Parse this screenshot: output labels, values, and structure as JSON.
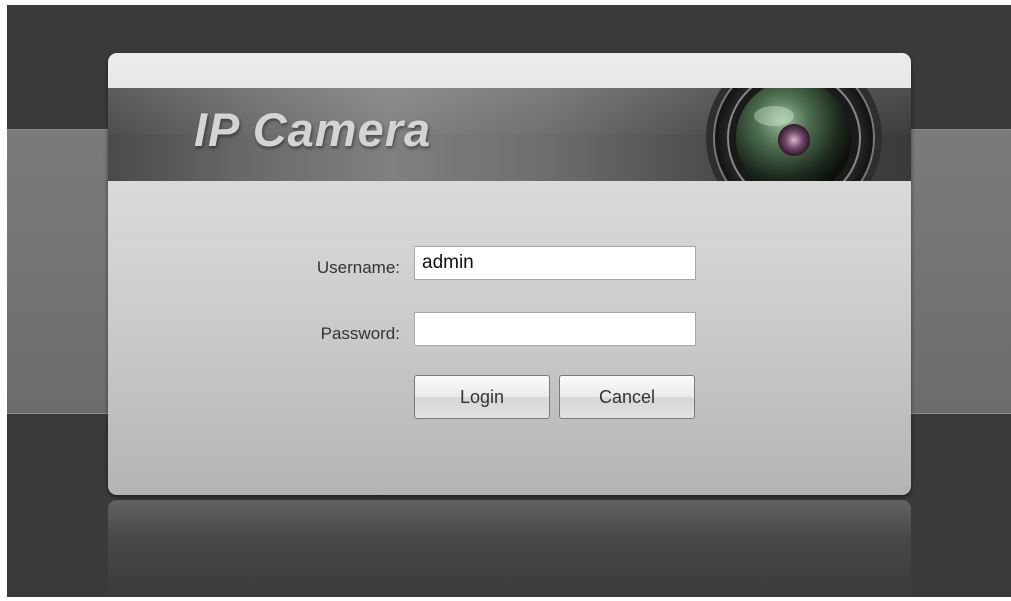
{
  "app": {
    "title": "IP Camera"
  },
  "login": {
    "username_label": "Username:",
    "username_value": "admin",
    "password_label": "Password:",
    "password_value": "",
    "login_label": "Login",
    "cancel_label": "Cancel"
  },
  "icons": {
    "banner_graphic": "camera-lens-icon"
  },
  "colors": {
    "background": "#3a3a3a",
    "band": "#737373",
    "panel_top": "#ececec",
    "panel_bottom": "#b4b4b4",
    "banner": "#6a6a6a",
    "title_text": "#d4d4d4"
  }
}
